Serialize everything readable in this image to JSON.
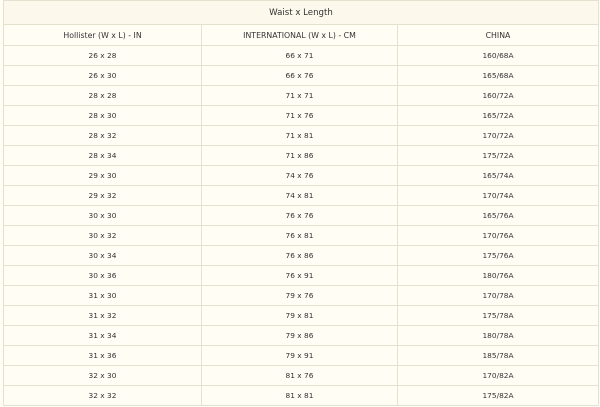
{
  "table": {
    "title": "Waist x Length",
    "headers": [
      "Hollister (W x L) - IN",
      "INTERNATIONAL (W x L) - CM",
      "CHINA"
    ],
    "rows": [
      [
        "26 x 28",
        "66 x 71",
        "160/68A"
      ],
      [
        "26 x 30",
        "66 x 76",
        "165/68A"
      ],
      [
        "28 x 28",
        "71 x 71",
        "160/72A"
      ],
      [
        "28 x 30",
        "71 x 76",
        "165/72A"
      ],
      [
        "28 x 32",
        "71 x 81",
        "170/72A"
      ],
      [
        "28 x 34",
        "71 x 86",
        "175/72A"
      ],
      [
        "29 x 30",
        "74 x 76",
        "165/74A"
      ],
      [
        "29 x 32",
        "74 x 81",
        "170/74A"
      ],
      [
        "30 x 30",
        "76 x 76",
        "165/76A"
      ],
      [
        "30 x 32",
        "76 x 81",
        "170/76A"
      ],
      [
        "30 x 34",
        "76 x 86",
        "175/76A"
      ],
      [
        "30 x 36",
        "76 x 91",
        "180/76A"
      ],
      [
        "31 x 30",
        "79 x 76",
        "170/78A"
      ],
      [
        "31 x 32",
        "79 x 81",
        "175/78A"
      ],
      [
        "31 x 34",
        "79 x 86",
        "180/78A"
      ],
      [
        "31 x 36",
        "79 x 91",
        "185/78A"
      ],
      [
        "32 x 30",
        "81 x 76",
        "170/82A"
      ],
      [
        "32 x 32",
        "81 x 81",
        "175/82A"
      ]
    ]
  }
}
